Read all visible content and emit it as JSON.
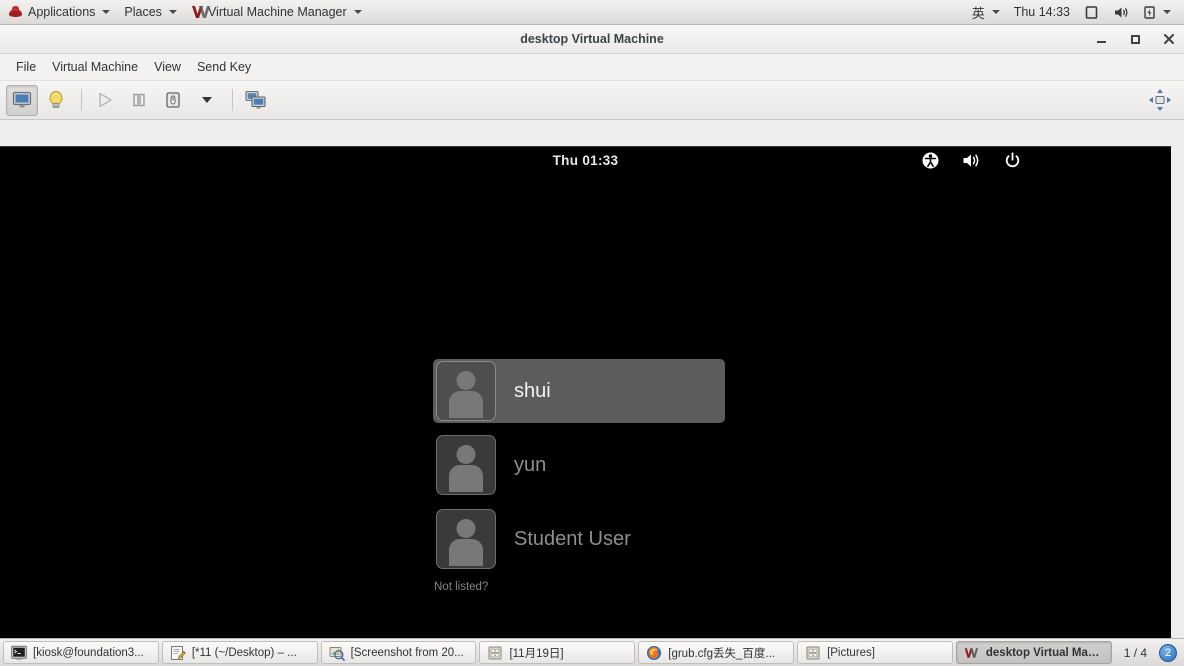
{
  "gnome_panel": {
    "applications_label": "Applications",
    "places_label": "Places",
    "window_title": "Virtual Machine Manager",
    "ime_label": "英",
    "clock": "Thu 14:33"
  },
  "vmm_window": {
    "title": "desktop Virtual Machine",
    "menu": [
      {
        "label": "File"
      },
      {
        "label": "Virtual Machine"
      },
      {
        "label": "View"
      },
      {
        "label": "Send Key"
      }
    ],
    "toolbar": {
      "console_tooltip": "Show the graphical console",
      "details_tooltip": "Show virtual hardware details",
      "run_tooltip": "Run",
      "pause_tooltip": "Pause",
      "shutdown_tooltip": "Shut down",
      "shutdown_menu_tooltip": "Shutdown options",
      "snapshot_tooltip": "Manage VM snapshots",
      "fullscreen_tooltip": "Fullscreen"
    },
    "controls": {
      "minimize": "-",
      "maximize": "□",
      "close": "✕"
    }
  },
  "vm_display": {
    "clock": "Thu 01:33",
    "status_icons": [
      {
        "name": "accessibility-icon"
      },
      {
        "name": "volume-icon"
      },
      {
        "name": "power-icon"
      }
    ],
    "users": [
      {
        "name": "shui",
        "selected": true
      },
      {
        "name": "yun",
        "selected": false
      },
      {
        "name": "Student User",
        "selected": false
      }
    ],
    "not_listed_label": "Not listed?"
  },
  "taskbar": {
    "items": [
      {
        "label": "[kiosk@foundation3...",
        "icon": "terminal-icon",
        "active": false
      },
      {
        "label": "[*11 (~/Desktop) – ...",
        "icon": "editor-icon",
        "active": false
      },
      {
        "label": "[Screenshot from 20...",
        "icon": "image-viewer-icon",
        "active": false
      },
      {
        "label": "[11月19日]",
        "icon": "file-manager-icon",
        "active": false
      },
      {
        "label": "[grub.cfg丢失_百度...",
        "icon": "firefox-icon",
        "active": false
      },
      {
        "label": "[Pictures]",
        "icon": "file-manager-icon",
        "active": false
      },
      {
        "label": "desktop Virtual Mac...",
        "icon": "vmm-icon",
        "active": true
      }
    ],
    "workspace_indicator": "1 / 4",
    "notification_count": "2"
  },
  "colors": {
    "panel_bg": "#ededed",
    "vm_screen_bg": "#000000",
    "selected_row_bg": "#5c5c5c",
    "accent_blue": "#2a6db5"
  }
}
